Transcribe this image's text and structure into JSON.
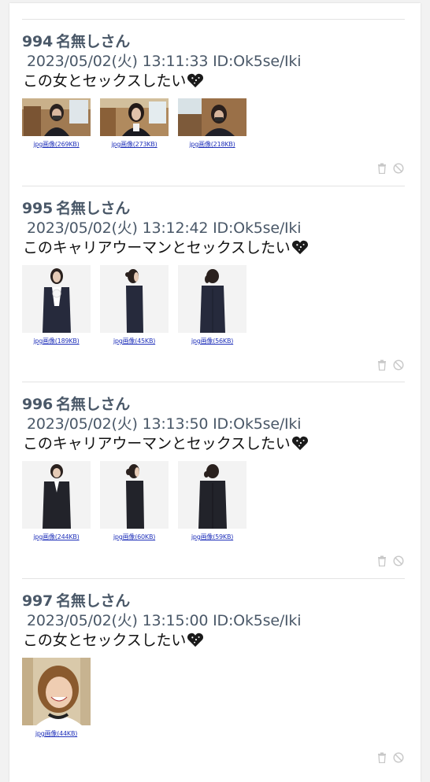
{
  "posts": [
    {
      "number": "994",
      "name": "名無しさん",
      "meta": "2023/05/02(火) 13:11:33 ID:Ok5se/Iki",
      "text": "この女とセックスしたい",
      "images": [
        {
          "caption": "jpg画像(269KB)"
        },
        {
          "caption": "jpg画像(273KB)"
        },
        {
          "caption": "jpg画像(218KB)"
        }
      ]
    },
    {
      "number": "995",
      "name": "名無しさん",
      "meta": "2023/05/02(火) 13:12:42 ID:Ok5se/Iki",
      "text": "このキャリアウーマンとセックスしたい",
      "images": [
        {
          "caption": "jpg画像(189KB)"
        },
        {
          "caption": "jpg画像(45KB)"
        },
        {
          "caption": "jpg画像(56KB)"
        }
      ]
    },
    {
      "number": "996",
      "name": "名無しさん",
      "meta": "2023/05/02(火) 13:13:50 ID:Ok5se/Iki",
      "text": "このキャリアウーマンとセックスしたい",
      "images": [
        {
          "caption": "jpg画像(244KB)"
        },
        {
          "caption": "jpg画像(60KB)"
        },
        {
          "caption": "jpg画像(59KB)"
        }
      ]
    },
    {
      "number": "997",
      "name": "名無しさん",
      "meta": "2023/05/02(火) 13:15:00 ID:Ok5se/Iki",
      "text": "この女とセックスしたい",
      "images": [
        {
          "caption": "jpg画像(44KB)"
        }
      ]
    }
  ],
  "icons": {
    "heart": "black-heart-icon",
    "delete": "trash-icon",
    "report": "block-icon"
  },
  "colors": {
    "header": "#4a5868",
    "link": "#2233bb",
    "icon": "#c8c8c8"
  }
}
